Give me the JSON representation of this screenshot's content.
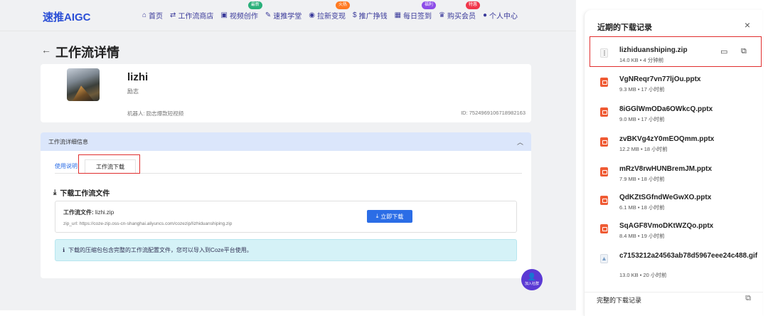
{
  "nav": {
    "brand": "速推AIGC",
    "items": [
      {
        "icon": "home-icon",
        "glyph": "⌂",
        "label": "首页",
        "badge": ""
      },
      {
        "icon": "swap-icon",
        "glyph": "⇄",
        "label": "工作流商店",
        "badge": ""
      },
      {
        "icon": "video-icon",
        "glyph": "▣",
        "label": "视频创作",
        "badge": "最新",
        "badge_color": "green"
      },
      {
        "icon": "graduation-icon",
        "glyph": "✎",
        "label": "速推学堂",
        "badge": ""
      },
      {
        "icon": "fire-icon",
        "glyph": "◉",
        "label": "拉新变现",
        "badge": "火热",
        "badge_color": "orange"
      },
      {
        "icon": "dollar-icon",
        "glyph": "$",
        "label": "推广挣钱",
        "badge": ""
      },
      {
        "icon": "calendar-icon",
        "glyph": "▦",
        "label": "每日签到",
        "badge": "福利",
        "badge_color": "purple"
      },
      {
        "icon": "crown-icon",
        "glyph": "♛",
        "label": "购买会员",
        "badge": "特惠",
        "badge_color": "red"
      },
      {
        "icon": "user-icon",
        "glyph": "●",
        "label": "个人中心",
        "badge": ""
      }
    ]
  },
  "page": {
    "back_glyph": "←",
    "title": "工作流详情"
  },
  "profile": {
    "name": "lizhi",
    "tag": "励志",
    "robot": "机器人: 励志爆款短视频",
    "id": "ID: 7524969106718982163"
  },
  "detail": {
    "header": "工作流详细信息",
    "chevron": "︿",
    "tabs": [
      "使用说明",
      "工作流下载"
    ],
    "download_heading": "下载工作流文件",
    "file_label": "工作流文件:",
    "file_name": "lizhi.zip",
    "zip_url": "zip_url: https://coze-zip.oss-cn-shanghai.aliyuncs.com/cozezip/lizhiduanshiping.zip",
    "download_button": "立即下载",
    "info_text": "下载的压缩包包含完整的工作流配置文件，您可以导入到Coze平台使用。"
  },
  "fab": {
    "label": "加入社群"
  },
  "downloads": {
    "title": "近期的下载记录",
    "close": "×",
    "footer": "完整的下载记录",
    "items": [
      {
        "type": "zip",
        "name": "lizhiduanshiping.zip",
        "meta": "14.0 KB • 4 分钟前"
      },
      {
        "type": "ppt",
        "name": "VgNReqr7vn77ljOu.pptx",
        "meta": "9.3 MB • 17 小时前"
      },
      {
        "type": "ppt",
        "name": "8iGGlWmODa6OWkcQ.pptx",
        "meta": "9.0 MB • 17 小时前"
      },
      {
        "type": "ppt",
        "name": "zvBKVg4zY0mEOQmm.pptx",
        "meta": "12.2 MB • 18 小时前"
      },
      {
        "type": "ppt",
        "name": "mRzV8rwHUNBremJM.pptx",
        "meta": "7.9 MB • 18 小时前"
      },
      {
        "type": "ppt",
        "name": "QdKZtSGfndWeGwXO.pptx",
        "meta": "6.1 MB • 18 小时前"
      },
      {
        "type": "ppt",
        "name": "SqAGF8VmoDKtWZQo.pptx",
        "meta": "8.4 MB • 19 小时前"
      },
      {
        "type": "gif",
        "name": "c7153212a24563ab78d5967eee24c488.gif",
        "meta": "13.0 KB • 20 小时前"
      }
    ]
  }
}
